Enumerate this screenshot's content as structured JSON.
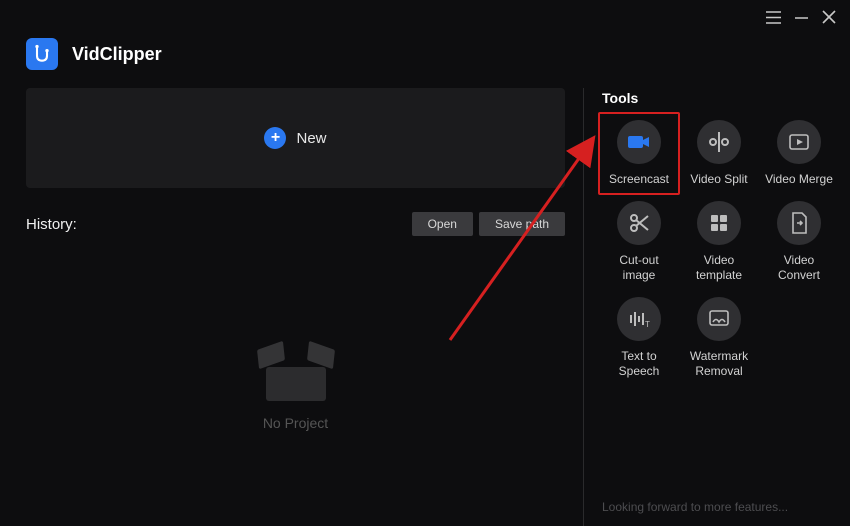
{
  "app": {
    "title": "VidClipper"
  },
  "new_panel": {
    "label": "New"
  },
  "history": {
    "label": "History:",
    "open_label": "Open",
    "save_path_label": "Save path",
    "empty_text": "No Project"
  },
  "tools": {
    "title": "Tools",
    "items": [
      {
        "label": "Screencast"
      },
      {
        "label": "Video Split"
      },
      {
        "label": "Video Merge"
      },
      {
        "label": "Cut-out image"
      },
      {
        "label": "Video template"
      },
      {
        "label": "Video Convert"
      },
      {
        "label": "Text to Speech"
      },
      {
        "label": "Watermark Removal"
      }
    ],
    "footer": "Looking forward to more features..."
  }
}
